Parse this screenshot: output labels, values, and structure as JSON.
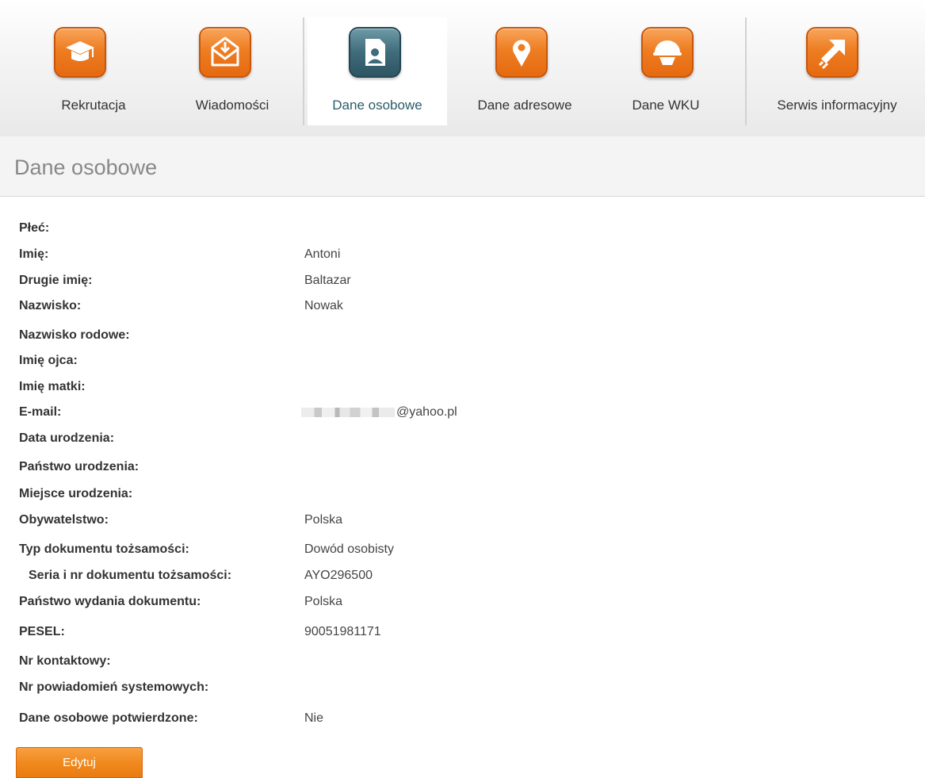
{
  "nav": {
    "items": [
      {
        "label": "Rekrutacja",
        "icon": "graduation-cap-icon",
        "active": false
      },
      {
        "label": "Wiadomości",
        "icon": "envelope-download-icon",
        "active": false
      },
      {
        "label": "Dane osobowe",
        "icon": "id-card-person-icon",
        "active": true
      },
      {
        "label": "Dane adresowe",
        "icon": "map-pin-icon",
        "active": false
      },
      {
        "label": "Dane WKU",
        "icon": "helmet-icon",
        "active": false
      },
      {
        "label": "Serwis informacyjny",
        "icon": "external-arrow-icon",
        "active": false
      }
    ]
  },
  "page": {
    "title": "Dane osobowe"
  },
  "fields": [
    {
      "label": "Płeć:",
      "value": ""
    },
    {
      "label": "Imię:",
      "value": "Antoni"
    },
    {
      "label": "Drugie imię:",
      "value": "Baltazar"
    },
    {
      "label": "Nazwisko:",
      "value": "Nowak"
    },
    {
      "label": "Nazwisko rodowe:",
      "value": ""
    },
    {
      "label": "Imię ojca:",
      "value": ""
    },
    {
      "label": "Imię matki:",
      "value": ""
    },
    {
      "label": "E-mail:",
      "value": "@yahoo.pl"
    },
    {
      "label": "Data urodzenia:",
      "value": ""
    },
    {
      "label": "Państwo urodzenia:",
      "value": ""
    },
    {
      "label": "Miejsce urodzenia:",
      "value": ""
    },
    {
      "label": "Obywatelstwo:",
      "value": "Polska"
    },
    {
      "label": "Typ dokumentu tożsamości:",
      "value": "Dowód osobisty"
    },
    {
      "label": "Seria i nr dokumentu tożsamości:",
      "value": "AYO296500"
    },
    {
      "label": "Państwo wydania dokumentu:",
      "value": "Polska"
    },
    {
      "label": "PESEL:",
      "value": "90051981171"
    },
    {
      "label": "Nr kontaktowy:",
      "value": ""
    },
    {
      "label": "Nr powiadomień systemowych:",
      "value": ""
    },
    {
      "label": "Dane osobowe potwierdzone:",
      "value": "Nie"
    }
  ],
  "actions": {
    "edit_label": "Edytuj"
  },
  "colors": {
    "accent": "#ee7d22",
    "active_icon": "#3f6c7b",
    "active_text": "#2c5c6b"
  }
}
